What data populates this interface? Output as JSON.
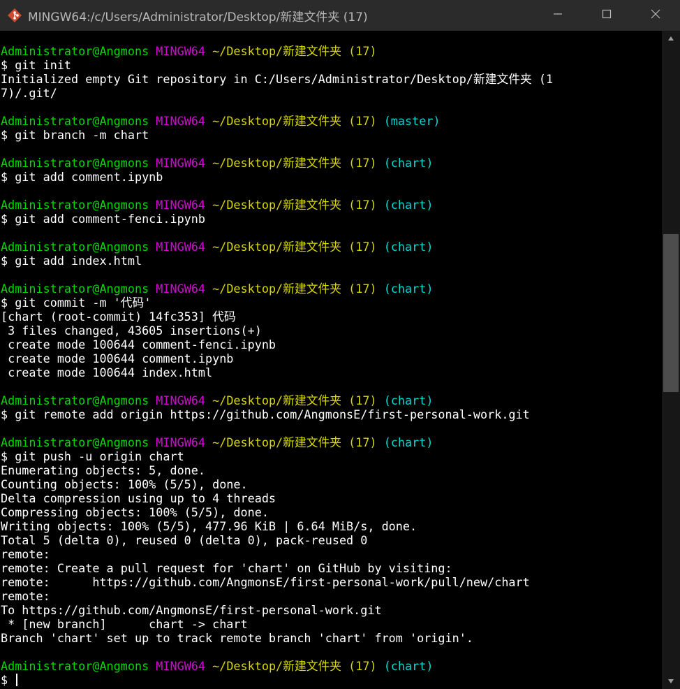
{
  "window": {
    "title": "MINGW64:/c/Users/Administrator/Desktop/新建文件夹 (17)",
    "app_icon": "git-bash-icon",
    "controls": [
      "minimize-icon",
      "maximize-icon",
      "close-icon"
    ]
  },
  "colors": {
    "prompt_user": "#00d700",
    "prompt_env": "#d700d7",
    "prompt_path": "#d7d700",
    "prompt_branch": "#00d7d7",
    "text": "#ffffff",
    "background": "#000000"
  },
  "scrollbar": {
    "position_fraction": 0.4
  },
  "terminal": {
    "lines": [
      {
        "type": "prompt",
        "user": "Administrator@Angmons",
        "env": "MINGW64",
        "path": "~/Desktop/新建文件夹 (17)",
        "branch": ""
      },
      {
        "type": "text",
        "text": "$ git init"
      },
      {
        "type": "text",
        "text": "Initialized empty Git repository in C:/Users/Administrator/Desktop/新建文件夹 (1"
      },
      {
        "type": "text",
        "text": "7)/.git/"
      },
      {
        "type": "blank",
        "text": ""
      },
      {
        "type": "prompt",
        "user": "Administrator@Angmons",
        "env": "MINGW64",
        "path": "~/Desktop/新建文件夹 (17)",
        "branch": "(master)"
      },
      {
        "type": "text",
        "text": "$ git branch -m chart"
      },
      {
        "type": "blank",
        "text": ""
      },
      {
        "type": "prompt",
        "user": "Administrator@Angmons",
        "env": "MINGW64",
        "path": "~/Desktop/新建文件夹 (17)",
        "branch": "(chart)"
      },
      {
        "type": "text",
        "text": "$ git add comment.ipynb"
      },
      {
        "type": "blank",
        "text": ""
      },
      {
        "type": "prompt",
        "user": "Administrator@Angmons",
        "env": "MINGW64",
        "path": "~/Desktop/新建文件夹 (17)",
        "branch": "(chart)"
      },
      {
        "type": "text",
        "text": "$ git add comment-fenci.ipynb"
      },
      {
        "type": "blank",
        "text": ""
      },
      {
        "type": "prompt",
        "user": "Administrator@Angmons",
        "env": "MINGW64",
        "path": "~/Desktop/新建文件夹 (17)",
        "branch": "(chart)"
      },
      {
        "type": "text",
        "text": "$ git add index.html"
      },
      {
        "type": "blank",
        "text": ""
      },
      {
        "type": "prompt",
        "user": "Administrator@Angmons",
        "env": "MINGW64",
        "path": "~/Desktop/新建文件夹 (17)",
        "branch": "(chart)"
      },
      {
        "type": "text",
        "text": "$ git commit -m '代码'"
      },
      {
        "type": "text",
        "text": "[chart (root-commit) 14fc353] 代码"
      },
      {
        "type": "text",
        "text": " 3 files changed, 43605 insertions(+)"
      },
      {
        "type": "text",
        "text": " create mode 100644 comment-fenci.ipynb"
      },
      {
        "type": "text",
        "text": " create mode 100644 comment.ipynb"
      },
      {
        "type": "text",
        "text": " create mode 100644 index.html"
      },
      {
        "type": "blank",
        "text": ""
      },
      {
        "type": "prompt",
        "user": "Administrator@Angmons",
        "env": "MINGW64",
        "path": "~/Desktop/新建文件夹 (17)",
        "branch": "(chart)"
      },
      {
        "type": "text",
        "text": "$ git remote add origin https://github.com/AngmonsE/first-personal-work.git"
      },
      {
        "type": "blank",
        "text": ""
      },
      {
        "type": "prompt",
        "user": "Administrator@Angmons",
        "env": "MINGW64",
        "path": "~/Desktop/新建文件夹 (17)",
        "branch": "(chart)"
      },
      {
        "type": "text",
        "text": "$ git push -u origin chart"
      },
      {
        "type": "text",
        "text": "Enumerating objects: 5, done."
      },
      {
        "type": "text",
        "text": "Counting objects: 100% (5/5), done."
      },
      {
        "type": "text",
        "text": "Delta compression using up to 4 threads"
      },
      {
        "type": "text",
        "text": "Compressing objects: 100% (5/5), done."
      },
      {
        "type": "text",
        "text": "Writing objects: 100% (5/5), 477.96 KiB | 6.64 MiB/s, done."
      },
      {
        "type": "text",
        "text": "Total 5 (delta 0), reused 0 (delta 0), pack-reused 0"
      },
      {
        "type": "text",
        "text": "remote:"
      },
      {
        "type": "text",
        "text": "remote: Create a pull request for 'chart' on GitHub by visiting:"
      },
      {
        "type": "text",
        "text": "remote:      https://github.com/AngmonsE/first-personal-work/pull/new/chart"
      },
      {
        "type": "text",
        "text": "remote:"
      },
      {
        "type": "text",
        "text": "To https://github.com/AngmonsE/first-personal-work.git"
      },
      {
        "type": "text",
        "text": " * [new branch]      chart -> chart"
      },
      {
        "type": "text",
        "text": "Branch 'chart' set up to track remote branch 'chart' from 'origin'."
      },
      {
        "type": "blank",
        "text": ""
      },
      {
        "type": "prompt",
        "user": "Administrator@Angmons",
        "env": "MINGW64",
        "path": "~/Desktop/新建文件夹 (17)",
        "branch": "(chart)"
      },
      {
        "type": "input",
        "text": "$ "
      }
    ]
  }
}
